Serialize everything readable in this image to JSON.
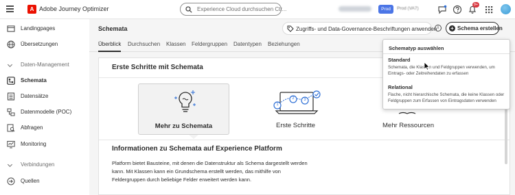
{
  "topbar": {
    "app_title": "Adobe Journey Optimizer",
    "adobe_logo_letter": "A",
    "search_placeholder": "Experience Cloud durchsuchen Ctr...",
    "prod_badge": "Prod",
    "prod_text": "Prod (VA7)",
    "notification_count": "9+"
  },
  "sidebar": {
    "items": [
      {
        "label": "Landingpages",
        "icon": "landing-page-icon"
      },
      {
        "label": "Übersetzungen",
        "icon": "globe-icon"
      },
      {
        "label": "Daten-Management",
        "section": true
      },
      {
        "label": "Schemata",
        "icon": "schema-icon",
        "active": true
      },
      {
        "label": "Datensätze",
        "icon": "dataset-icon"
      },
      {
        "label": "Datenmodelle (POC)",
        "icon": "data-model-icon"
      },
      {
        "label": "Abfragen",
        "icon": "query-icon"
      },
      {
        "label": "Monitoring",
        "icon": "monitoring-icon"
      },
      {
        "label": "Verbindungen",
        "section": true
      },
      {
        "label": "Quellen",
        "icon": "sources-icon"
      }
    ]
  },
  "header": {
    "title": "Schemata",
    "governance_button": "Zugriffs- und Data-Governance-Beschriftungen anwenden",
    "info_glyph": "i",
    "create_button": "Schema erstellen",
    "create_glyph": "+"
  },
  "tabs": [
    "Überblick",
    "Durchsuchen",
    "Klassen",
    "Feldergruppen",
    "Datentypen",
    "Beziehungen"
  ],
  "card": {
    "title": "Erste Schritte mit Schemata",
    "tiles": [
      {
        "label": "Mehr zu Schemata",
        "selected": true
      },
      {
        "label": "Erste Schritte",
        "selected": false
      },
      {
        "label": "Mehr Ressourcen",
        "selected": false
      }
    ],
    "step_numbers": [
      "1",
      "2",
      "3"
    ],
    "info_title": "Informationen zu Schemata auf Experience Platform",
    "info_body": "Platform bietet Bausteine, mit denen die Datenstruktur als Schema dargestellt werden kann. Mit Klassen kann ein Grundschema erstellt werden, das mithilfe von Feldergruppen durch beliebige Felder erweitert werden kann."
  },
  "popover": {
    "heading": "Schematyp auswählen",
    "options": [
      {
        "title": "Standard",
        "description": "Schemata, die Klassen und Feldgruppen verwenden, um Eintrags- oder Zeitreihendaten zu erfassen"
      },
      {
        "title": "Relational",
        "description": "Flache, nicht hierarchische Schemata, die keine Klassen oder Feldgruppen zum Erfassen von Eintragsdaten verwenden"
      }
    ]
  },
  "colors": {
    "accent_blue": "#4b75e6",
    "adobe_red": "#eb1000",
    "badge_red": "#d7373f",
    "illustration_blue": "#2e6fd6"
  }
}
